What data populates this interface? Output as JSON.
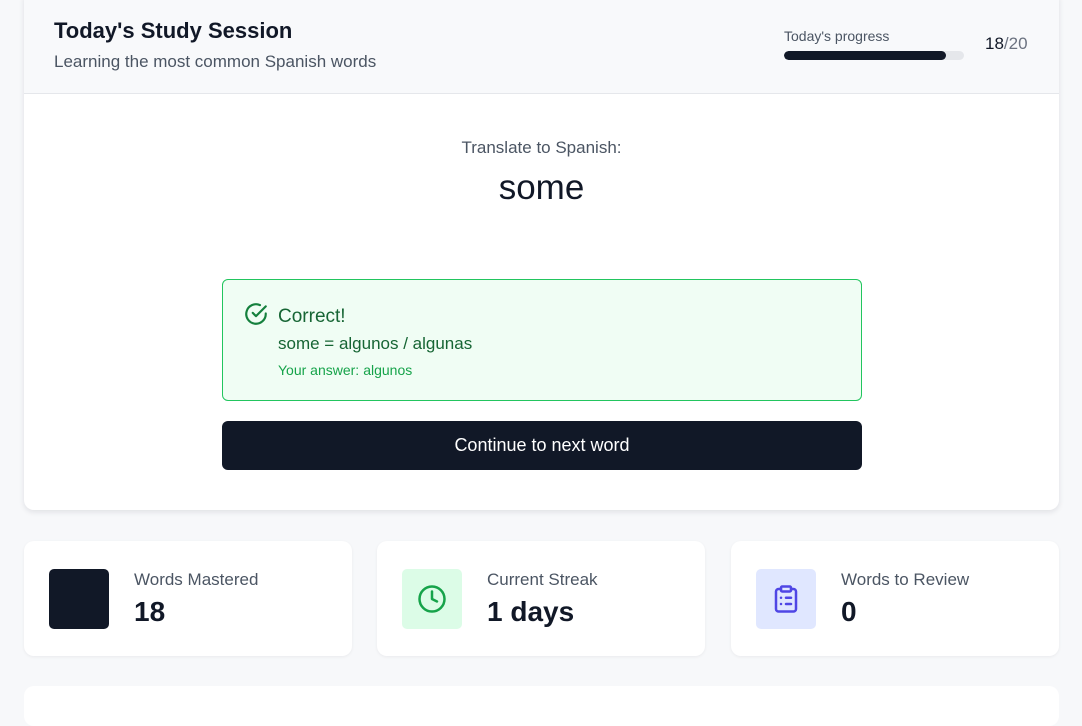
{
  "session": {
    "title": "Today's Study Session",
    "subtitle": "Learning the most common Spanish words",
    "progress": {
      "label": "Today's progress",
      "done": "18",
      "separator": "/",
      "total": "20",
      "fraction": 0.9
    }
  },
  "prompt": {
    "label": "Translate to Spanish:",
    "word": "some"
  },
  "feedback": {
    "title": "Correct!",
    "translation": "some = algunos / algunas",
    "answer_label": "Your answer:",
    "answer_value": "algunos",
    "icon": "check-circle-icon"
  },
  "continue_button": {
    "label": "Continue to next word"
  },
  "stats": [
    {
      "label": "Words Mastered",
      "value": "18",
      "icon": "blank-icon",
      "icon_bg": "#111827"
    },
    {
      "label": "Current Streak",
      "value": "1 days",
      "icon": "clock-icon",
      "icon_bg": "#dcfce7",
      "icon_color": "#16a34a"
    },
    {
      "label": "Words to Review",
      "value": "0",
      "icon": "clipboard-list-icon",
      "icon_bg": "#e0e7ff",
      "icon_color": "#4f46e5"
    }
  ],
  "colors": {
    "primary": "#111827",
    "success": "#16a34a",
    "success_bg": "#f0fdf4",
    "review_accent": "#4f46e5"
  }
}
